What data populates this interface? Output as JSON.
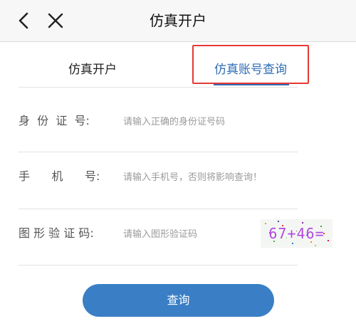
{
  "header": {
    "title": "仿真开户",
    "back_icon": "chevron-left-icon",
    "close_icon": "close-icon"
  },
  "tabs": [
    {
      "label": "仿真开户",
      "active": false
    },
    {
      "label": "仿真账号查询",
      "active": true
    }
  ],
  "form": {
    "id_number": {
      "label": "身  份  证  号:",
      "placeholder": "请输入正确的身份证号码",
      "value": ""
    },
    "phone": {
      "label": "手      机      号:",
      "placeholder": "请输入手机号，否则将影响查询！",
      "value": ""
    },
    "captcha": {
      "label": "图 形 验 证 码:",
      "placeholder": "请输入图形验证码",
      "value": "",
      "image_text": "67+46="
    }
  },
  "submit": {
    "label": "查询"
  },
  "colors": {
    "accent": "#2f6db5",
    "button": "#3a7fc5",
    "highlight": "#e53935"
  }
}
